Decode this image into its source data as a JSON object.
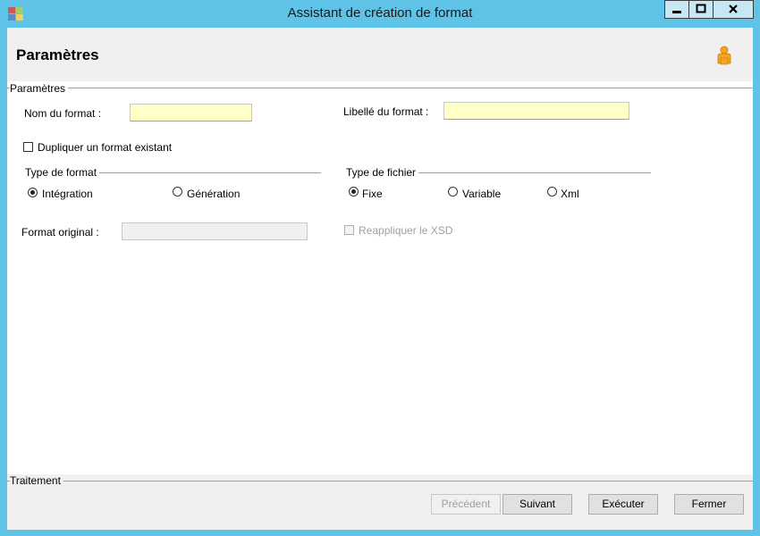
{
  "window": {
    "title": "Assistant de création de format",
    "min_symbol": "▬",
    "max_symbol": "□",
    "close_symbol": "✕"
  },
  "header": {
    "title": "Paramètres"
  },
  "params_group": {
    "legend": "Paramètres",
    "nom_label": "Nom du format :",
    "nom_value": "",
    "libelle_label": "Libellé du format :",
    "libelle_value": "",
    "dupliquer_label": "Dupliquer un format existant",
    "dupliquer_checked": false,
    "type_format": {
      "legend": "Type de format",
      "options": [
        "Intégration",
        "Génération"
      ],
      "selected": "Intégration"
    },
    "type_fichier": {
      "legend": "Type de fichier",
      "options": [
        "Fixe",
        "Variable",
        "Xml"
      ],
      "selected": "Fixe"
    },
    "format_original_label": "Format original :",
    "format_original_value": "",
    "reappliquer_label": "Reappliquer le XSD",
    "reappliquer_enabled": false
  },
  "traitement_group": {
    "legend": "Traitement"
  },
  "buttons": {
    "precedent": "Précédent",
    "suivant": "Suivant",
    "executer": "Exécuter",
    "fermer": "Fermer"
  },
  "colors": {
    "frame": "#5ec3e6",
    "input_bg": "#ffffc8",
    "panel_bg": "#f0f0f0"
  }
}
